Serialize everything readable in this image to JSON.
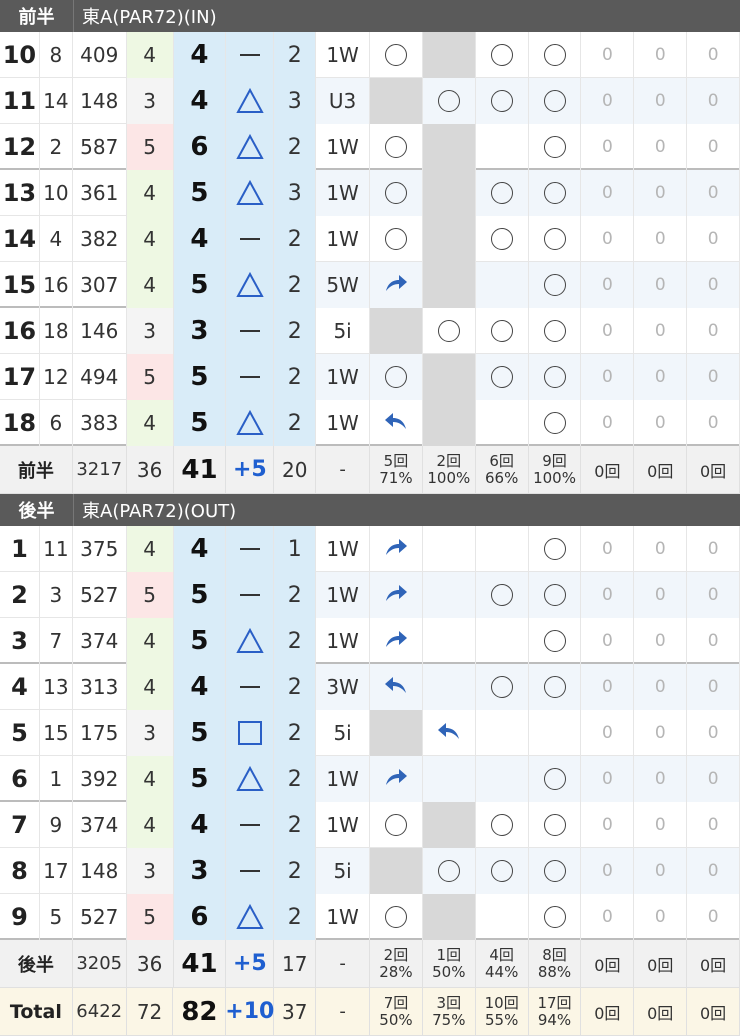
{
  "front": {
    "label": "前半",
    "course": "東A(PAR72)(IN)",
    "holes": [
      {
        "hole": "10",
        "hdcp": "8",
        "yard": "409",
        "par": "4",
        "score": "4",
        "mark": "dash",
        "putt": "2",
        "club": "1W",
        "fw": "circle",
        "on": "gray",
        "st1": "circle",
        "st2": "circle",
        "z": [
          "0",
          "0",
          "0"
        ]
      },
      {
        "hole": "11",
        "hdcp": "14",
        "yard": "148",
        "par": "3",
        "score": "4",
        "mark": "triangle",
        "putt": "3",
        "club": "U3",
        "fw": "gray",
        "on": "circle",
        "st1": "circle",
        "st2": "circle",
        "z": [
          "0",
          "0",
          "0"
        ]
      },
      {
        "hole": "12",
        "hdcp": "2",
        "yard": "587",
        "par": "5",
        "score": "6",
        "mark": "triangle",
        "putt": "2",
        "club": "1W",
        "fw": "circle",
        "on": "gray",
        "st1": "",
        "st2": "circle",
        "z": [
          "0",
          "0",
          "0"
        ],
        "groupEnd": true
      },
      {
        "hole": "13",
        "hdcp": "10",
        "yard": "361",
        "par": "4",
        "score": "5",
        "mark": "triangle",
        "putt": "3",
        "club": "1W",
        "fw": "circle",
        "on": "gray",
        "st1": "circle",
        "st2": "circle",
        "z": [
          "0",
          "0",
          "0"
        ]
      },
      {
        "hole": "14",
        "hdcp": "4",
        "yard": "382",
        "par": "4",
        "score": "4",
        "mark": "dash",
        "putt": "2",
        "club": "1W",
        "fw": "circle",
        "on": "gray",
        "st1": "circle",
        "st2": "circle",
        "z": [
          "0",
          "0",
          "0"
        ]
      },
      {
        "hole": "15",
        "hdcp": "16",
        "yard": "307",
        "par": "4",
        "score": "5",
        "mark": "triangle",
        "putt": "2",
        "club": "5W",
        "fw": "right-arrow",
        "on": "gray",
        "st1": "",
        "st2": "circle",
        "z": [
          "0",
          "0",
          "0"
        ],
        "groupEnd": true
      },
      {
        "hole": "16",
        "hdcp": "18",
        "yard": "146",
        "par": "3",
        "score": "3",
        "mark": "dash",
        "putt": "2",
        "club": "5i",
        "fw": "gray",
        "on": "circle",
        "st1": "circle",
        "st2": "circle",
        "z": [
          "0",
          "0",
          "0"
        ]
      },
      {
        "hole": "17",
        "hdcp": "12",
        "yard": "494",
        "par": "5",
        "score": "5",
        "mark": "dash",
        "putt": "2",
        "club": "1W",
        "fw": "circle",
        "on": "gray",
        "st1": "circle",
        "st2": "circle",
        "z": [
          "0",
          "0",
          "0"
        ]
      },
      {
        "hole": "18",
        "hdcp": "6",
        "yard": "383",
        "par": "4",
        "score": "5",
        "mark": "triangle",
        "putt": "2",
        "club": "1W",
        "fw": "left-arrow",
        "on": "gray",
        "st1": "",
        "st2": "circle",
        "z": [
          "0",
          "0",
          "0"
        ],
        "groupEnd": true
      }
    ],
    "summary": {
      "label": "前半",
      "yard": "3217",
      "par": "36",
      "score": "41",
      "diff": "+5",
      "putt": "20",
      "dash": "-",
      "stats": [
        [
          "5回",
          "71%"
        ],
        [
          "2回",
          "100%"
        ],
        [
          "6回",
          "66%"
        ],
        [
          "9回",
          "100%"
        ]
      ],
      "zeros": [
        "0回",
        "0回",
        "0回"
      ]
    }
  },
  "back": {
    "label": "後半",
    "course": "東A(PAR72)(OUT)",
    "holes": [
      {
        "hole": "1",
        "hdcp": "11",
        "yard": "375",
        "par": "4",
        "score": "4",
        "mark": "dash",
        "putt": "1",
        "club": "1W",
        "fw": "right-arrow",
        "on": "",
        "st1": "",
        "st2": "circle",
        "z": [
          "0",
          "0",
          "0"
        ]
      },
      {
        "hole": "2",
        "hdcp": "3",
        "yard": "527",
        "par": "5",
        "score": "5",
        "mark": "dash",
        "putt": "2",
        "club": "1W",
        "fw": "right-arrow",
        "on": "",
        "st1": "circle",
        "st2": "circle",
        "z": [
          "0",
          "0",
          "0"
        ]
      },
      {
        "hole": "3",
        "hdcp": "7",
        "yard": "374",
        "par": "4",
        "score": "5",
        "mark": "triangle",
        "putt": "2",
        "club": "1W",
        "fw": "right-arrow",
        "on": "",
        "st1": "",
        "st2": "circle",
        "z": [
          "0",
          "0",
          "0"
        ],
        "groupEnd": true
      },
      {
        "hole": "4",
        "hdcp": "13",
        "yard": "313",
        "par": "4",
        "score": "4",
        "mark": "dash",
        "putt": "2",
        "club": "3W",
        "fw": "left-arrow",
        "on": "",
        "st1": "circle",
        "st2": "circle",
        "z": [
          "0",
          "0",
          "0"
        ]
      },
      {
        "hole": "5",
        "hdcp": "15",
        "yard": "175",
        "par": "3",
        "score": "5",
        "mark": "square",
        "putt": "2",
        "club": "5i",
        "fw": "gray",
        "on": "left-arrow",
        "st1": "",
        "st2": "",
        "z": [
          "0",
          "0",
          "0"
        ]
      },
      {
        "hole": "6",
        "hdcp": "1",
        "yard": "392",
        "par": "4",
        "score": "5",
        "mark": "triangle",
        "putt": "2",
        "club": "1W",
        "fw": "right-arrow",
        "on": "",
        "st1": "",
        "st2": "circle",
        "z": [
          "0",
          "0",
          "0"
        ],
        "groupEnd": true
      },
      {
        "hole": "7",
        "hdcp": "9",
        "yard": "374",
        "par": "4",
        "score": "4",
        "mark": "dash",
        "putt": "2",
        "club": "1W",
        "fw": "circle",
        "on": "gray",
        "st1": "circle",
        "st2": "circle",
        "z": [
          "0",
          "0",
          "0"
        ]
      },
      {
        "hole": "8",
        "hdcp": "17",
        "yard": "148",
        "par": "3",
        "score": "3",
        "mark": "dash",
        "putt": "2",
        "club": "5i",
        "fw": "gray",
        "on": "circle",
        "st1": "circle",
        "st2": "circle",
        "z": [
          "0",
          "0",
          "0"
        ]
      },
      {
        "hole": "9",
        "hdcp": "5",
        "yard": "527",
        "par": "5",
        "score": "6",
        "mark": "triangle",
        "putt": "2",
        "club": "1W",
        "fw": "circle",
        "on": "gray",
        "st1": "",
        "st2": "circle",
        "z": [
          "0",
          "0",
          "0"
        ],
        "groupEnd": true
      }
    ],
    "summary": {
      "label": "後半",
      "yard": "3205",
      "par": "36",
      "score": "41",
      "diff": "+5",
      "putt": "17",
      "dash": "-",
      "stats": [
        [
          "2回",
          "28%"
        ],
        [
          "1回",
          "50%"
        ],
        [
          "4回",
          "44%"
        ],
        [
          "8回",
          "88%"
        ]
      ],
      "zeros": [
        "0回",
        "0回",
        "0回"
      ]
    }
  },
  "total": {
    "label": "Total",
    "yard": "6422",
    "par": "72",
    "score": "82",
    "diff": "+10",
    "putt": "37",
    "dash": "-",
    "stats": [
      [
        "7回",
        "50%"
      ],
      [
        "3回",
        "75%"
      ],
      [
        "10回",
        "55%"
      ],
      [
        "17回",
        "94%"
      ]
    ],
    "zeros": [
      "0回",
      "0回",
      "0回"
    ]
  },
  "colors": {
    "accent": "#1f5fd0",
    "scoreBg": "#d9ecf8",
    "header": "#5a5a5a"
  }
}
